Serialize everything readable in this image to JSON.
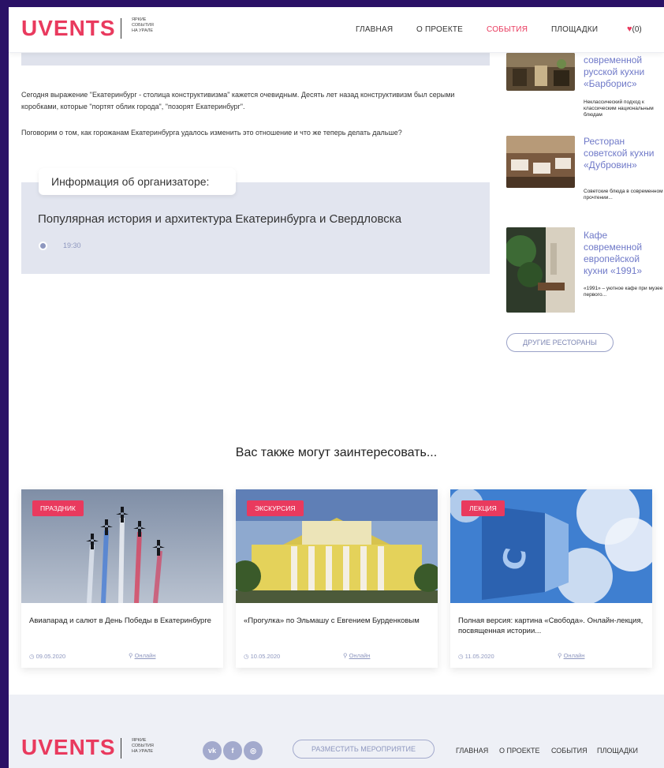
{
  "header": {
    "logo": "UVENTS",
    "logo_tagline": [
      "Яркие",
      "события",
      "на Урале"
    ],
    "nav": [
      "Главная",
      "О проекте",
      "События",
      "Площадки"
    ],
    "active_nav": "События",
    "favorites": "(0)"
  },
  "article": {
    "paragraph1": "Сегодня выражение \"Екатеринбург - столица конструктивизма\" кажется очевидным. Десять лет назад конструктивизм был серыми коробками, которые \"портят облик города\", \"позорят Екатеринбург\".",
    "paragraph2": "Поговорим о том, как горожанам Екатеринбурга удалось изменить это отношение и что же теперь делать дальше?",
    "organizer_label": "Информация об организаторе:",
    "organizer_name": "Популярная история и архитектура Екатеринбурга и Свердловска",
    "time": "19:30"
  },
  "sidebar": {
    "restaurants": [
      {
        "title": "современной русской кухни «Барборис»",
        "desc": "Неклассический подход к классическим национальным блюдам"
      },
      {
        "title": "Ресторан советской кухни «Дубровин»",
        "desc": "Советские блюда в современном прочтении..."
      },
      {
        "title": "Кафе современной европейской кухни «1991»",
        "desc": "«1991» – уютное кафе при музее первого..."
      }
    ],
    "other_button": "Другие рестораны"
  },
  "also": {
    "title": "Вас также могут заинтересовать...",
    "cards": [
      {
        "tag": "Праздник",
        "title": "Авиапарад и салют в День Победы в Екатеринбурге",
        "date": "09.05.2020",
        "location": "Онлайн"
      },
      {
        "tag": "Экскурсия",
        "title": "«Прогулка» по Эльмашу с Евгением Бурденковым",
        "date": "10.05.2020",
        "location": "Онлайн"
      },
      {
        "tag": "Лекция",
        "title": "Полная версия: картина «Свобода». Онлайн-лекция, посвященная истории...",
        "date": "11.05.2020",
        "location": "Онлайн"
      }
    ]
  },
  "footer": {
    "logo": "UVENTS",
    "social": [
      "vk",
      "f",
      "ig"
    ],
    "place_button": "Разместить мероприятие",
    "nav": [
      "Главная",
      "О проекте",
      "События",
      "Площадки"
    ]
  },
  "colors": {
    "accent": "#e93a5e",
    "muted": "#8e97bf",
    "link": "#6f79c8"
  }
}
